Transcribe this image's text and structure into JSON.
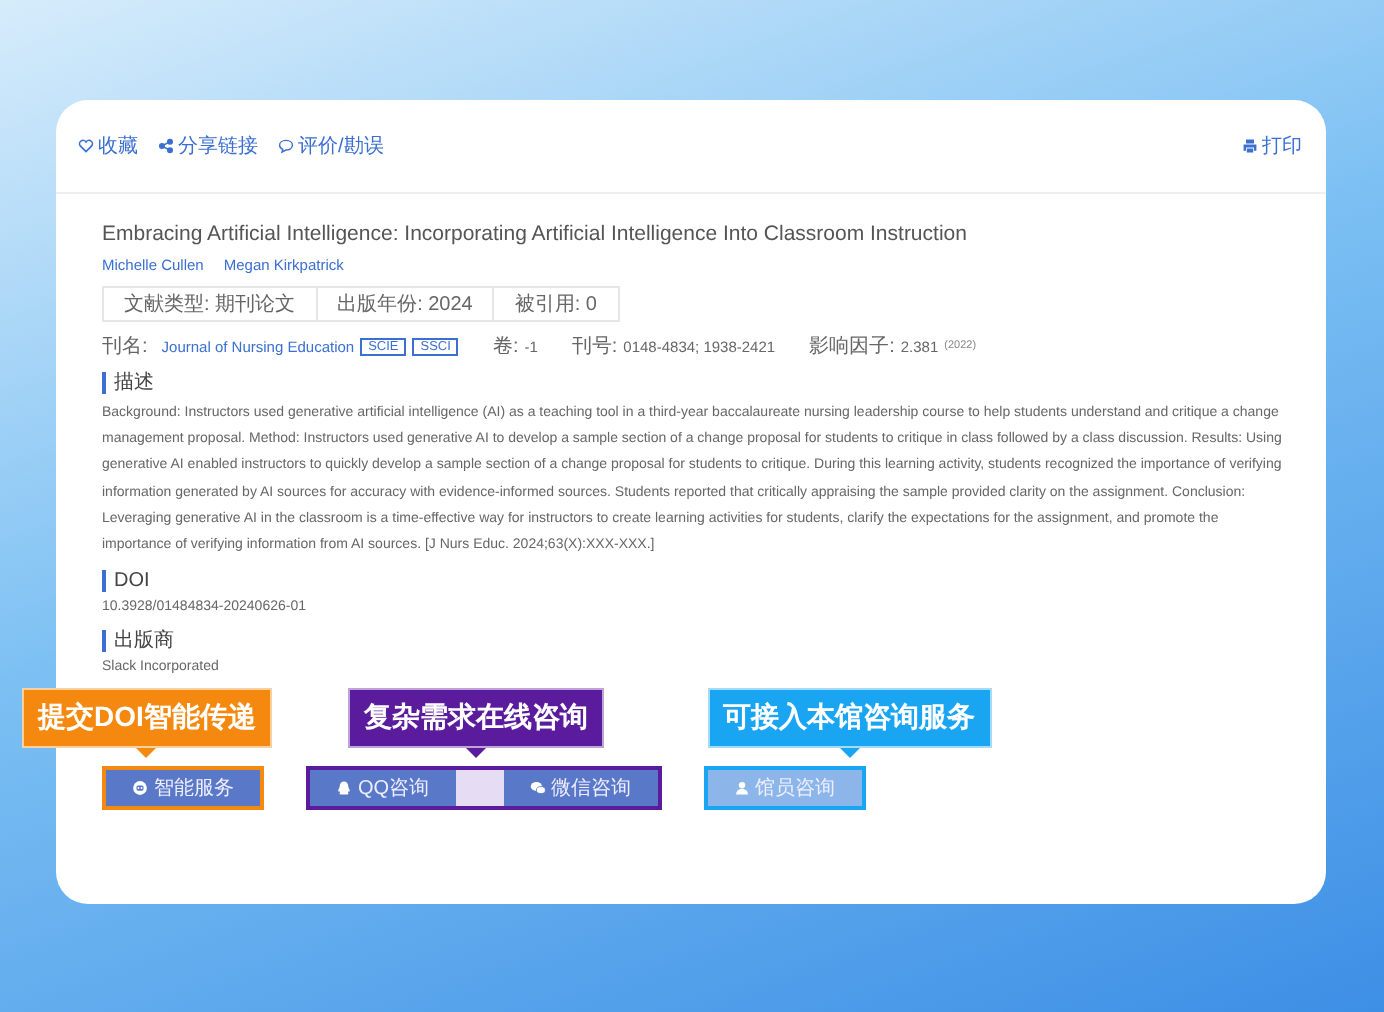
{
  "toolbar": {
    "actions": [
      {
        "kind": "heart",
        "label": "收藏"
      },
      {
        "kind": "share",
        "label": "分享链接"
      },
      {
        "kind": "comment",
        "label": "评价/勘误"
      }
    ],
    "print": {
      "label": "打印"
    }
  },
  "article": {
    "title": "Embracing Artificial Intelligence: Incorporating Artificial Intelligence Into Classroom Instruction",
    "authors": [
      "Michelle Cullen",
      "Megan Kirkpatrick"
    ],
    "chips": [
      "文献类型: 期刊论文",
      "出版年份: 2024",
      "被引用: 0"
    ],
    "journal": {
      "label": "刊名:",
      "name": "Journal of Nursing Education",
      "badges": [
        "SCIE",
        "SSCI"
      ]
    },
    "volume": {
      "label": "卷:",
      "value": "-1"
    },
    "issn": {
      "label": "刊号:",
      "value": "0148-4834; 1938-2421"
    },
    "impact": {
      "label": "影响因子:",
      "value": "2.381",
      "year": "(2022)"
    }
  },
  "sections": [
    {
      "heading": "描述",
      "text": "Background: Instructors used generative artificial intelligence (AI) as a teaching tool in a third-year baccalaureate nursing leadership course to help students understand and critique a change management proposal. Method: Instructors used generative AI to develop a sample section of a change proposal for students to critique in class followed by a class discussion. Results: Using generative AI enabled instructors to quickly develop a sample section of a change proposal for students to critique. During this learning activity, students recognized the importance of verifying information generated by AI sources for accuracy with evidence-informed sources. Students reported that critically appraising the sample provided clarity on the assignment. Conclusion: Leveraging generative AI in the classroom is a time-effective way for instructors to create learning activities for students, clarify the expectations for the assignment, and promote the importance of verifying information from AI sources. [J Nurs Educ. 2024;63(X):XXX-XXX.]"
    },
    {
      "heading": "DOI",
      "text": "10.3928/01484834-20240626-01"
    },
    {
      "heading": "出版商",
      "text": "Slack Incorporated"
    }
  ],
  "services": [
    {
      "callout": "提交DOI智能传递",
      "color": "#f5890f",
      "buttons": [
        {
          "kind": "robot",
          "label": "智能服务"
        }
      ]
    },
    {
      "callout": "复杂需求在线咨询",
      "color": "#5a1b9c",
      "buttons": [
        {
          "kind": "qq",
          "label": "QQ咨询"
        },
        {
          "kind": "blank"
        },
        {
          "kind": "wechat",
          "label": "微信咨询"
        }
      ]
    },
    {
      "callout": "可接入本馆咨询服务",
      "color": "#1aa5f3",
      "buttons": [
        {
          "kind": "user",
          "label": "馆员咨询"
        }
      ]
    }
  ]
}
